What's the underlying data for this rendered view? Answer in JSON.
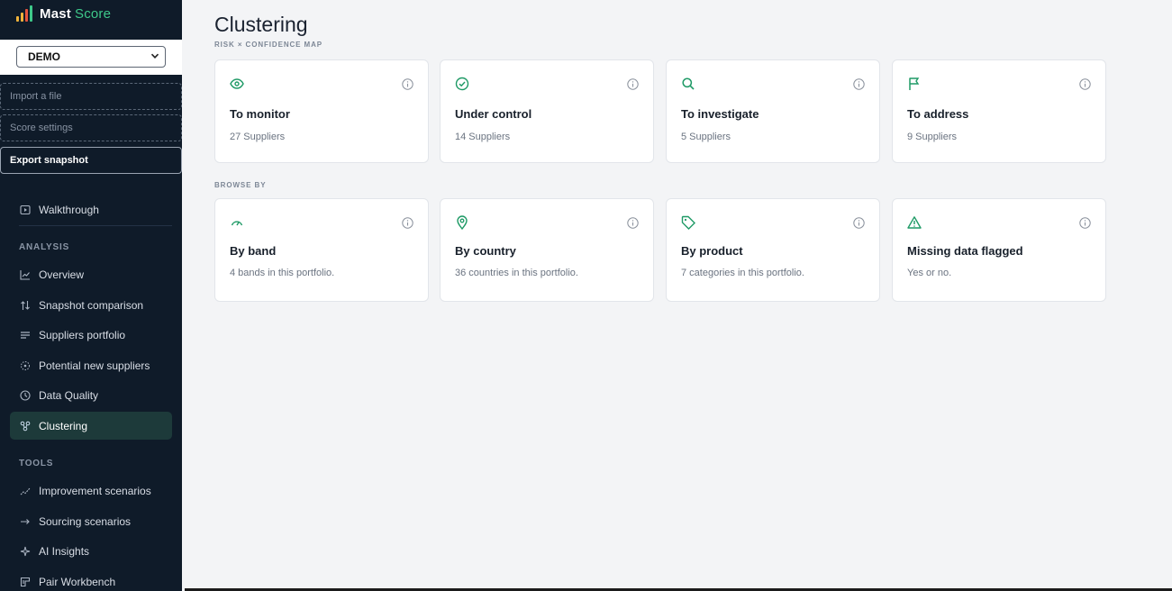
{
  "brand": {
    "name": "Mast",
    "accent": "Score",
    "bar_colors": [
      "#f0b33a",
      "#f0b33a",
      "#e5543d",
      "#3ec98a"
    ]
  },
  "snapshot": {
    "selected": "DEMO"
  },
  "sidebar": {
    "import_label": "Import a file",
    "settings_label": "Score settings",
    "export_label": "Export snapshot",
    "walkthrough_label": "Walkthrough",
    "analysis_heading": "ANALYSIS",
    "analysis_items": [
      {
        "label": "Overview",
        "icon": "chart-line-icon"
      },
      {
        "label": "Snapshot comparison",
        "icon": "arrows-updown-icon"
      },
      {
        "label": "Suppliers portfolio",
        "icon": "list-icon"
      },
      {
        "label": "Potential new suppliers",
        "icon": "sparkle-icon"
      },
      {
        "label": "Data Quality",
        "icon": "clock-icon"
      },
      {
        "label": "Clustering",
        "icon": "cluster-icon",
        "active": true
      }
    ],
    "tools_heading": "TOOLS",
    "tools_items": [
      {
        "label": "Improvement scenarios",
        "icon": "trend-icon"
      },
      {
        "label": "Sourcing scenarios",
        "icon": "arrow-right-icon"
      },
      {
        "label": "AI Insights",
        "icon": "star-icon"
      },
      {
        "label": "Pair Workbench",
        "icon": "workbench-icon"
      }
    ]
  },
  "main": {
    "title": "Clustering",
    "subtitle": "RISK × CONFIDENCE MAP",
    "risk_cards": [
      {
        "title": "To monitor",
        "sub": "27 Suppliers",
        "icon": "eye-icon"
      },
      {
        "title": "Under control",
        "sub": "14 Suppliers",
        "icon": "check-circle-icon"
      },
      {
        "title": "To investigate",
        "sub": "5 Suppliers",
        "icon": "search-icon"
      },
      {
        "title": "To address",
        "sub": "9 Suppliers",
        "icon": "flag-icon"
      }
    ],
    "browse_label": "BROWSE BY",
    "browse_cards": [
      {
        "title": "By band",
        "sub": "4 bands in this portfolio.",
        "icon": "gauge-icon"
      },
      {
        "title": "By country",
        "sub": "36 countries in this portfolio.",
        "icon": "map-pin-icon"
      },
      {
        "title": "By product",
        "sub": "7 categories in this portfolio.",
        "icon": "tag-icon"
      },
      {
        "title": "Missing data flagged",
        "sub": "Yes or no.",
        "icon": "warning-icon"
      }
    ]
  },
  "colors": {
    "sidebar_bg": "#0f1b29",
    "accent": "#1f9a66",
    "active_nav": "#1d3a3a"
  }
}
